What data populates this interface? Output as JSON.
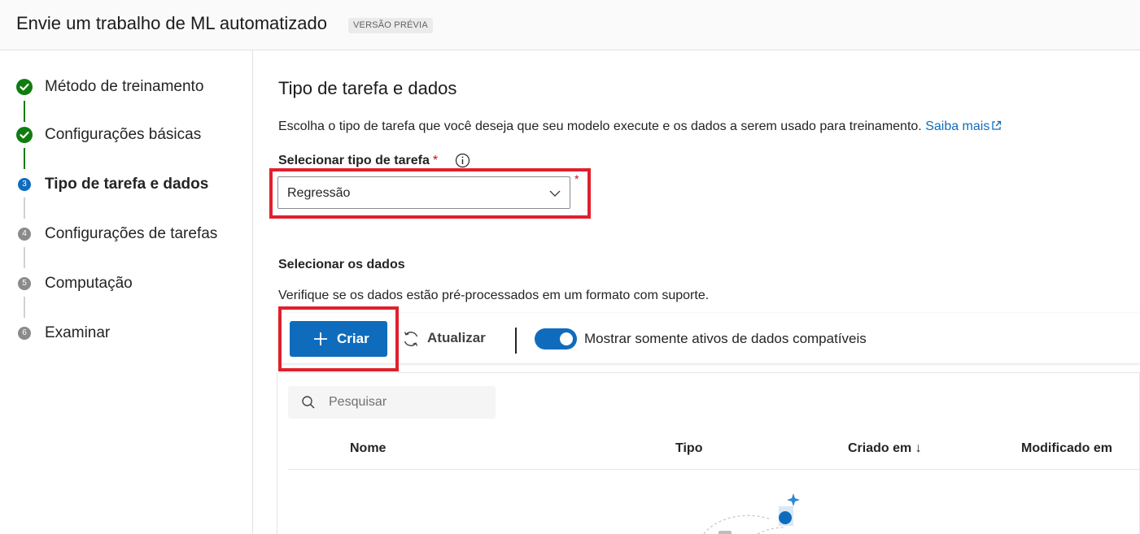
{
  "header": {
    "title": "Envie um trabalho de ML automatizado",
    "badge": "VERSÃO PRÉVIA"
  },
  "steps": [
    {
      "number": "",
      "label": "Método de treinamento",
      "state": "done"
    },
    {
      "number": "",
      "label": "Configurações básicas",
      "state": "done"
    },
    {
      "number": "3",
      "label": "Tipo de tarefa e dados",
      "state": "active"
    },
    {
      "number": "4",
      "label": "Configurações de tarefas",
      "state": "pending"
    },
    {
      "number": "5",
      "label": "Computação",
      "state": "pending"
    },
    {
      "number": "6",
      "label": "Examinar",
      "state": "pending"
    }
  ],
  "main": {
    "title": "Tipo de tarefa e dados",
    "description": "Escolha o tipo de tarefa que você deseja que seu modelo execute e os dados a serem usado para treinamento.",
    "learn_more": "Saiba mais",
    "task_type_label": "Selecionar tipo de tarefa",
    "required_mark": "*",
    "task_type_value": "Regressão",
    "data_title": "Selecionar os dados",
    "data_description": "Verifique se os dados estão pré-processados em um formato com suporte.",
    "toolbar": {
      "create": "Criar",
      "refresh": "Atualizar",
      "toggle_label": "Mostrar somente ativos de dados compatíveis",
      "toggle_on": true
    },
    "search": {
      "placeholder": "Pesquisar"
    },
    "columns": [
      "Nome",
      "Tipo",
      "Criado em ↓",
      "Modificado em"
    ]
  },
  "colors": {
    "accent": "#0f6cbd",
    "success": "#107c10",
    "highlight": "#e0202d",
    "required": "#c50f1f"
  }
}
